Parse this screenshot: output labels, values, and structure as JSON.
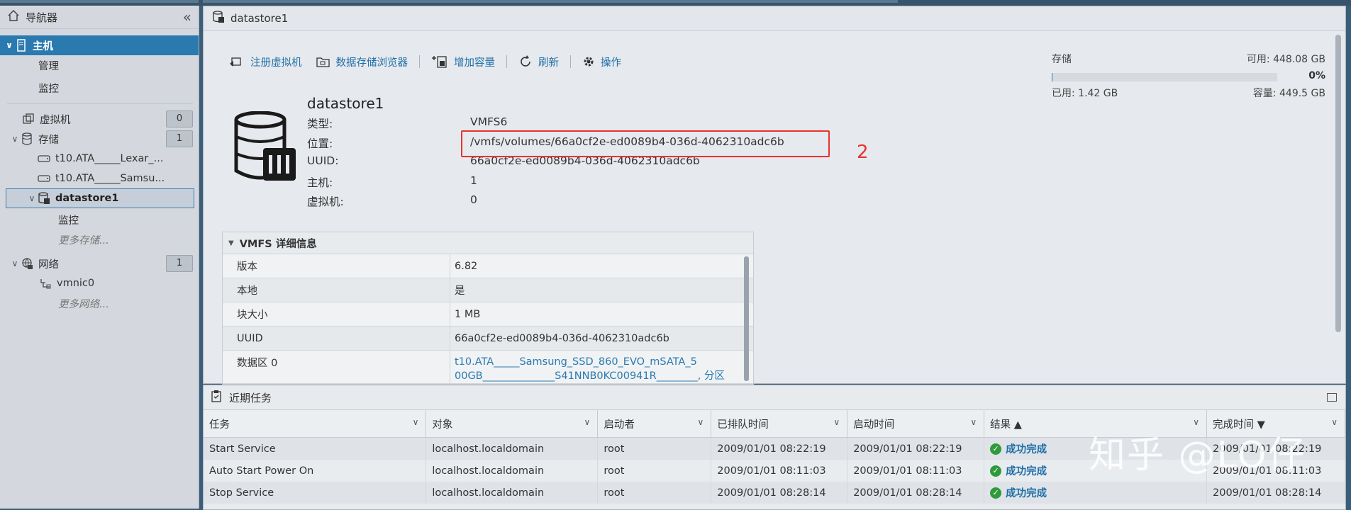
{
  "navigator": {
    "title": "导航器",
    "host": "主机",
    "host_children": [
      "管理",
      "监控"
    ],
    "vms": {
      "label": "虚拟机",
      "count": "0"
    },
    "storage": {
      "label": "存储",
      "count": "1"
    },
    "storage_children": [
      "t10.ATA_____Lexar_...",
      "t10.ATA_____Samsu...",
      "datastore1"
    ],
    "ds_child": "监控",
    "more_storage": "更多存储...",
    "network": {
      "label": "网络",
      "count": "1"
    },
    "network_child": "vmnic0",
    "more_network": "更多网络..."
  },
  "main": {
    "title": "datastore1",
    "toolbar": {
      "register_vm": "注册虚拟机",
      "browser": "数据存储浏览器",
      "increase": "增加容量",
      "refresh": "刷新",
      "actions": "操作"
    },
    "datastore_name": "datastore1",
    "props": [
      {
        "key": "类型:",
        "value": "VMFS6"
      },
      {
        "key": "位置:",
        "value": "/vmfs/volumes/66a0cf2e-ed0089b4-036d-4062310adc6b"
      },
      {
        "key": "UUID:",
        "value": "66a0cf2e-ed0089b4-036d-4062310adc6b"
      },
      {
        "key": "主机:",
        "value": "1"
      },
      {
        "key": "虚拟机:",
        "value": "0"
      }
    ],
    "annotation": "2",
    "storage": {
      "label": "存储",
      "free": "可用: 448.08 GB",
      "percent": "0%",
      "used": "已用: 1.42 GB",
      "capacity": "容量: 449.5 GB",
      "used_fraction": 0.003
    },
    "vmfs": {
      "title": "VMFS 详细信息",
      "rows": [
        {
          "key": "版本",
          "value": "6.82"
        },
        {
          "key": "本地",
          "value": "是"
        },
        {
          "key": "块大小",
          "value": "1 MB"
        },
        {
          "key": "UUID",
          "value": "66a0cf2e-ed0089b4-036d-4062310adc6b"
        },
        {
          "key": "数据区 0",
          "value": "t10.ATA_____Samsung_SSD_860_EVO_mSATA_5",
          "value2": "00GB______________S41NNB0KC00941R________, 分区"
        }
      ]
    }
  },
  "tasks": {
    "title": "近期任务",
    "columns": [
      "任务",
      "对象",
      "启动者",
      "已排队时间",
      "启动时间",
      "结果 ▲",
      "完成时间 ▼"
    ],
    "rows": [
      {
        "task": "Start Service",
        "object": "localhost.localdomain",
        "initiator": "root",
        "queued": "2009/01/01 08:22:19",
        "started": "2009/01/01 08:22:19",
        "result": "成功完成",
        "completed": "2009/01/01 08:22:19"
      },
      {
        "task": "Auto Start Power On",
        "object": "localhost.localdomain",
        "initiator": "root",
        "queued": "2009/01/01 08:11:03",
        "started": "2009/01/01 08:11:03",
        "result": "成功完成",
        "completed": "2009/01/01 08:11:03"
      },
      {
        "task": "Stop Service",
        "object": "localhost.localdomain",
        "initiator": "root",
        "queued": "2009/01/01 08:28:14",
        "started": "2009/01/01 08:28:14",
        "result": "成功完成",
        "completed": "2009/01/01 08:28:14"
      }
    ]
  },
  "watermark": "知乎 @LO仔",
  "colors": {
    "accent": "#2a7ab0",
    "highlight": "#e8332f",
    "success": "#2f9a3c"
  }
}
